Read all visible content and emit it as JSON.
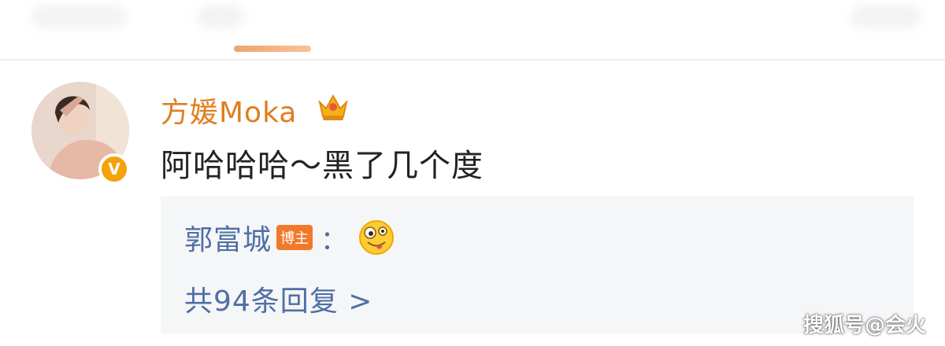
{
  "comment": {
    "username": "方媛Moka",
    "text": "阿哈哈哈～黑了几个度",
    "badge_icon": "verified-v-icon",
    "crown_icon": "crown-icon"
  },
  "reply": {
    "author": "郭富城",
    "tag": "博主",
    "colon": "：",
    "emoji": "zany-face-emoji",
    "count_label": "共94条回复 >"
  },
  "watermark": "搜狐号@会火",
  "colors": {
    "username": "#e07d1e",
    "link_blue": "#4f6fa3",
    "tag_orange": "#f07a2a",
    "badge_yellow": "#f5a20a",
    "tab_indicator": "#f2a36b"
  }
}
